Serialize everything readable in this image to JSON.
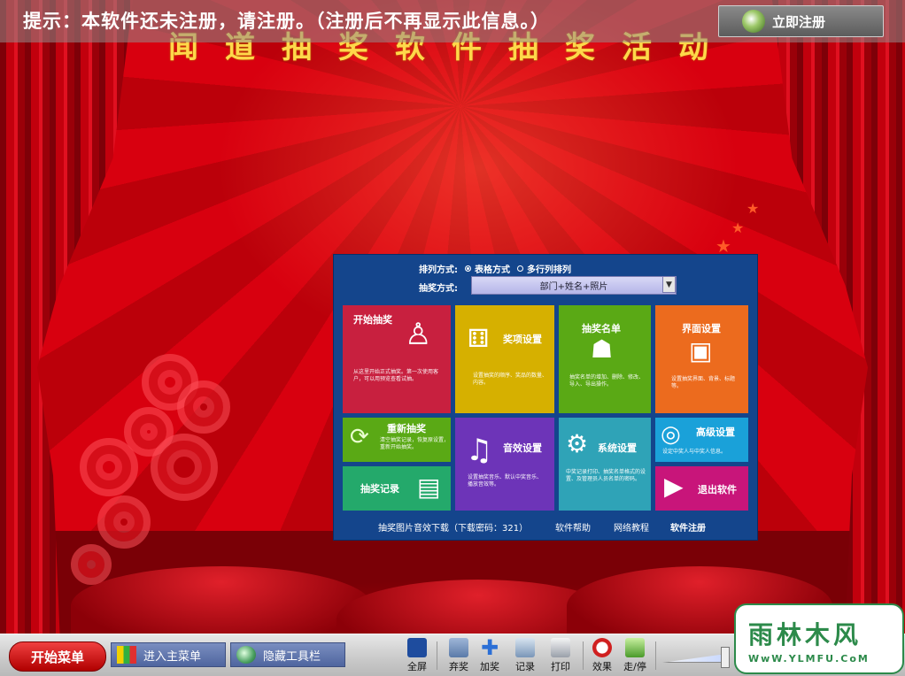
{
  "notice": {
    "text": "提示：本软件还未注册，请注册。（注册后不再显示此信息。）",
    "register_button": "立即注册"
  },
  "title": "闻道抽奖软件抽奖活动",
  "panel": {
    "arrange_label": "排列方式:",
    "arrange_options": [
      "表格方式",
      "多行列排列"
    ],
    "arrange_selected": "表格方式",
    "draw_label": "抽奖方式:",
    "draw_value": "部门+姓名+照片",
    "tiles": {
      "start": {
        "title": "开始抽奖",
        "desc": "从这里开始正式抽奖。第一次使用客户，可以用预览查看试抽。",
        "color": "#c8203f"
      },
      "prize": {
        "title": "奖项设置",
        "desc": "设置抽奖的顺序、奖品的数量、内容。",
        "color": "#d6b000"
      },
      "list": {
        "title": "抽奖名单",
        "desc": "抽奖名单的增加、删除、修改、导入、导出操作。",
        "color": "#5aa915"
      },
      "ui": {
        "title": "界面设置",
        "desc": "设置抽奖界面、背景、标题等。",
        "color": "#ec6b1e"
      },
      "redraw": {
        "title": "重新抽奖",
        "desc": "清空抽奖记录，恢复原设置，重新开始抽奖。",
        "color": "#5aa915"
      },
      "sound": {
        "title": "音效设置",
        "desc": "设置抽奖音乐、默认中奖音乐、播放音效等。",
        "color": "#6d34b8"
      },
      "system": {
        "title": "系统设置",
        "desc": "中奖记录打印、抽奖名单格式的设置、及管理员人员名单的密码。",
        "color": "#2fa3b7"
      },
      "advanced": {
        "title": "高级设置",
        "desc": "设定中奖人与中奖人信息。",
        "color": "#1aa1d9"
      },
      "record": {
        "title": "抽奖记录",
        "desc": "",
        "color": "#24a96b"
      },
      "exit": {
        "title": "退出软件",
        "desc": "",
        "color": "#c8157a"
      }
    },
    "links": {
      "download": "抽奖图片音效下载（下载密码：321）",
      "help": "软件帮助",
      "tutorial": "网络教程",
      "register": "软件注册"
    }
  },
  "taskbar": {
    "start_menu": "开始菜单",
    "main_menu": "进入主菜单",
    "hide_toolbar": "隐藏工具栏",
    "tools": [
      "全屏",
      "弃奖",
      "加奖",
      "记录",
      "打印",
      "效果",
      "走/停"
    ]
  },
  "watermark": {
    "brand": "雨林木风",
    "url": "WwW.YLMFU.CoM"
  }
}
